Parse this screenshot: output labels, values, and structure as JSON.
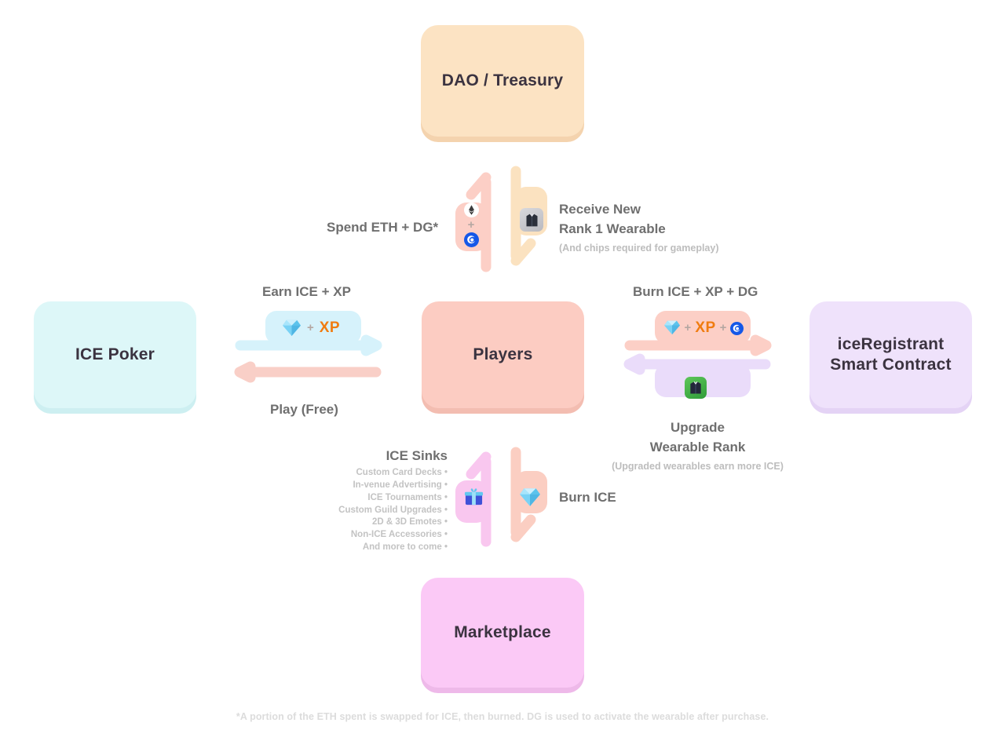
{
  "diagram": {
    "title": "ICE Poker token flow",
    "footnote": "*A portion of the ETH spent is swapped for ICE, then burned. DG is used to activate the wearable after purchase."
  },
  "nodes": {
    "dao": {
      "label": "DAO / Treasury",
      "color": "#fce3c3"
    },
    "ice_poker": {
      "label": "ICE Poker",
      "color": "#ddf7f8"
    },
    "players": {
      "label": "Players",
      "color": "#fcccc2"
    },
    "contract": {
      "line1": "iceRegistrant",
      "line2": "Smart Contract",
      "color": "#efe2fb"
    },
    "marketplace": {
      "label": "Marketplace",
      "color": "#fbc9f6"
    }
  },
  "flows": {
    "spend": {
      "label": "Spend ETH + DG*",
      "tokens": [
        "eth-token-icon",
        "plus",
        "dg-token-icon"
      ],
      "color": "#fccfc6"
    },
    "receive": {
      "line1": "Receive New",
      "line2": "Rank 1 Wearable",
      "note": "(And chips required for gameplay)",
      "icon": "wearable-rank1-icon",
      "color": "#fbe2c0"
    },
    "earn": {
      "label": "Earn ICE + XP",
      "items": [
        "ice-gem-icon",
        "plus",
        "XP"
      ],
      "color": "#d6f2fb"
    },
    "play": {
      "label": "Play (Free)",
      "color": "#f9cfc7"
    },
    "burn_right": {
      "label": "Burn ICE + XP + DG",
      "items": [
        "ice-gem-icon",
        "plus",
        "XP",
        "plus",
        "dg-token-icon"
      ],
      "color": "#fccfc6"
    },
    "upgrade": {
      "line1": "Upgrade",
      "line2": "Wearable Rank",
      "note": "(Upgraded wearables earn more ICE)",
      "icon": "wearable-upgraded-icon",
      "color": "#eadcfa"
    },
    "ice_sinks": {
      "heading": "ICE Sinks",
      "items": [
        "Custom Card Decks  •",
        "In-venue Advertising  •",
        "ICE Tournaments  •",
        "Custom Guild Upgrades  •",
        "2D & 3D Emotes  •",
        "Non-ICE Accessories  •",
        "And more to come  •"
      ],
      "icon": "gift-box-icon",
      "color": "#f9c7ef"
    },
    "burn_ice": {
      "label": "Burn ICE",
      "icon": "ice-gem-icon",
      "color": "#fbcec2"
    }
  },
  "tokens": {
    "xp_text": "XP",
    "plus_text": "+"
  }
}
